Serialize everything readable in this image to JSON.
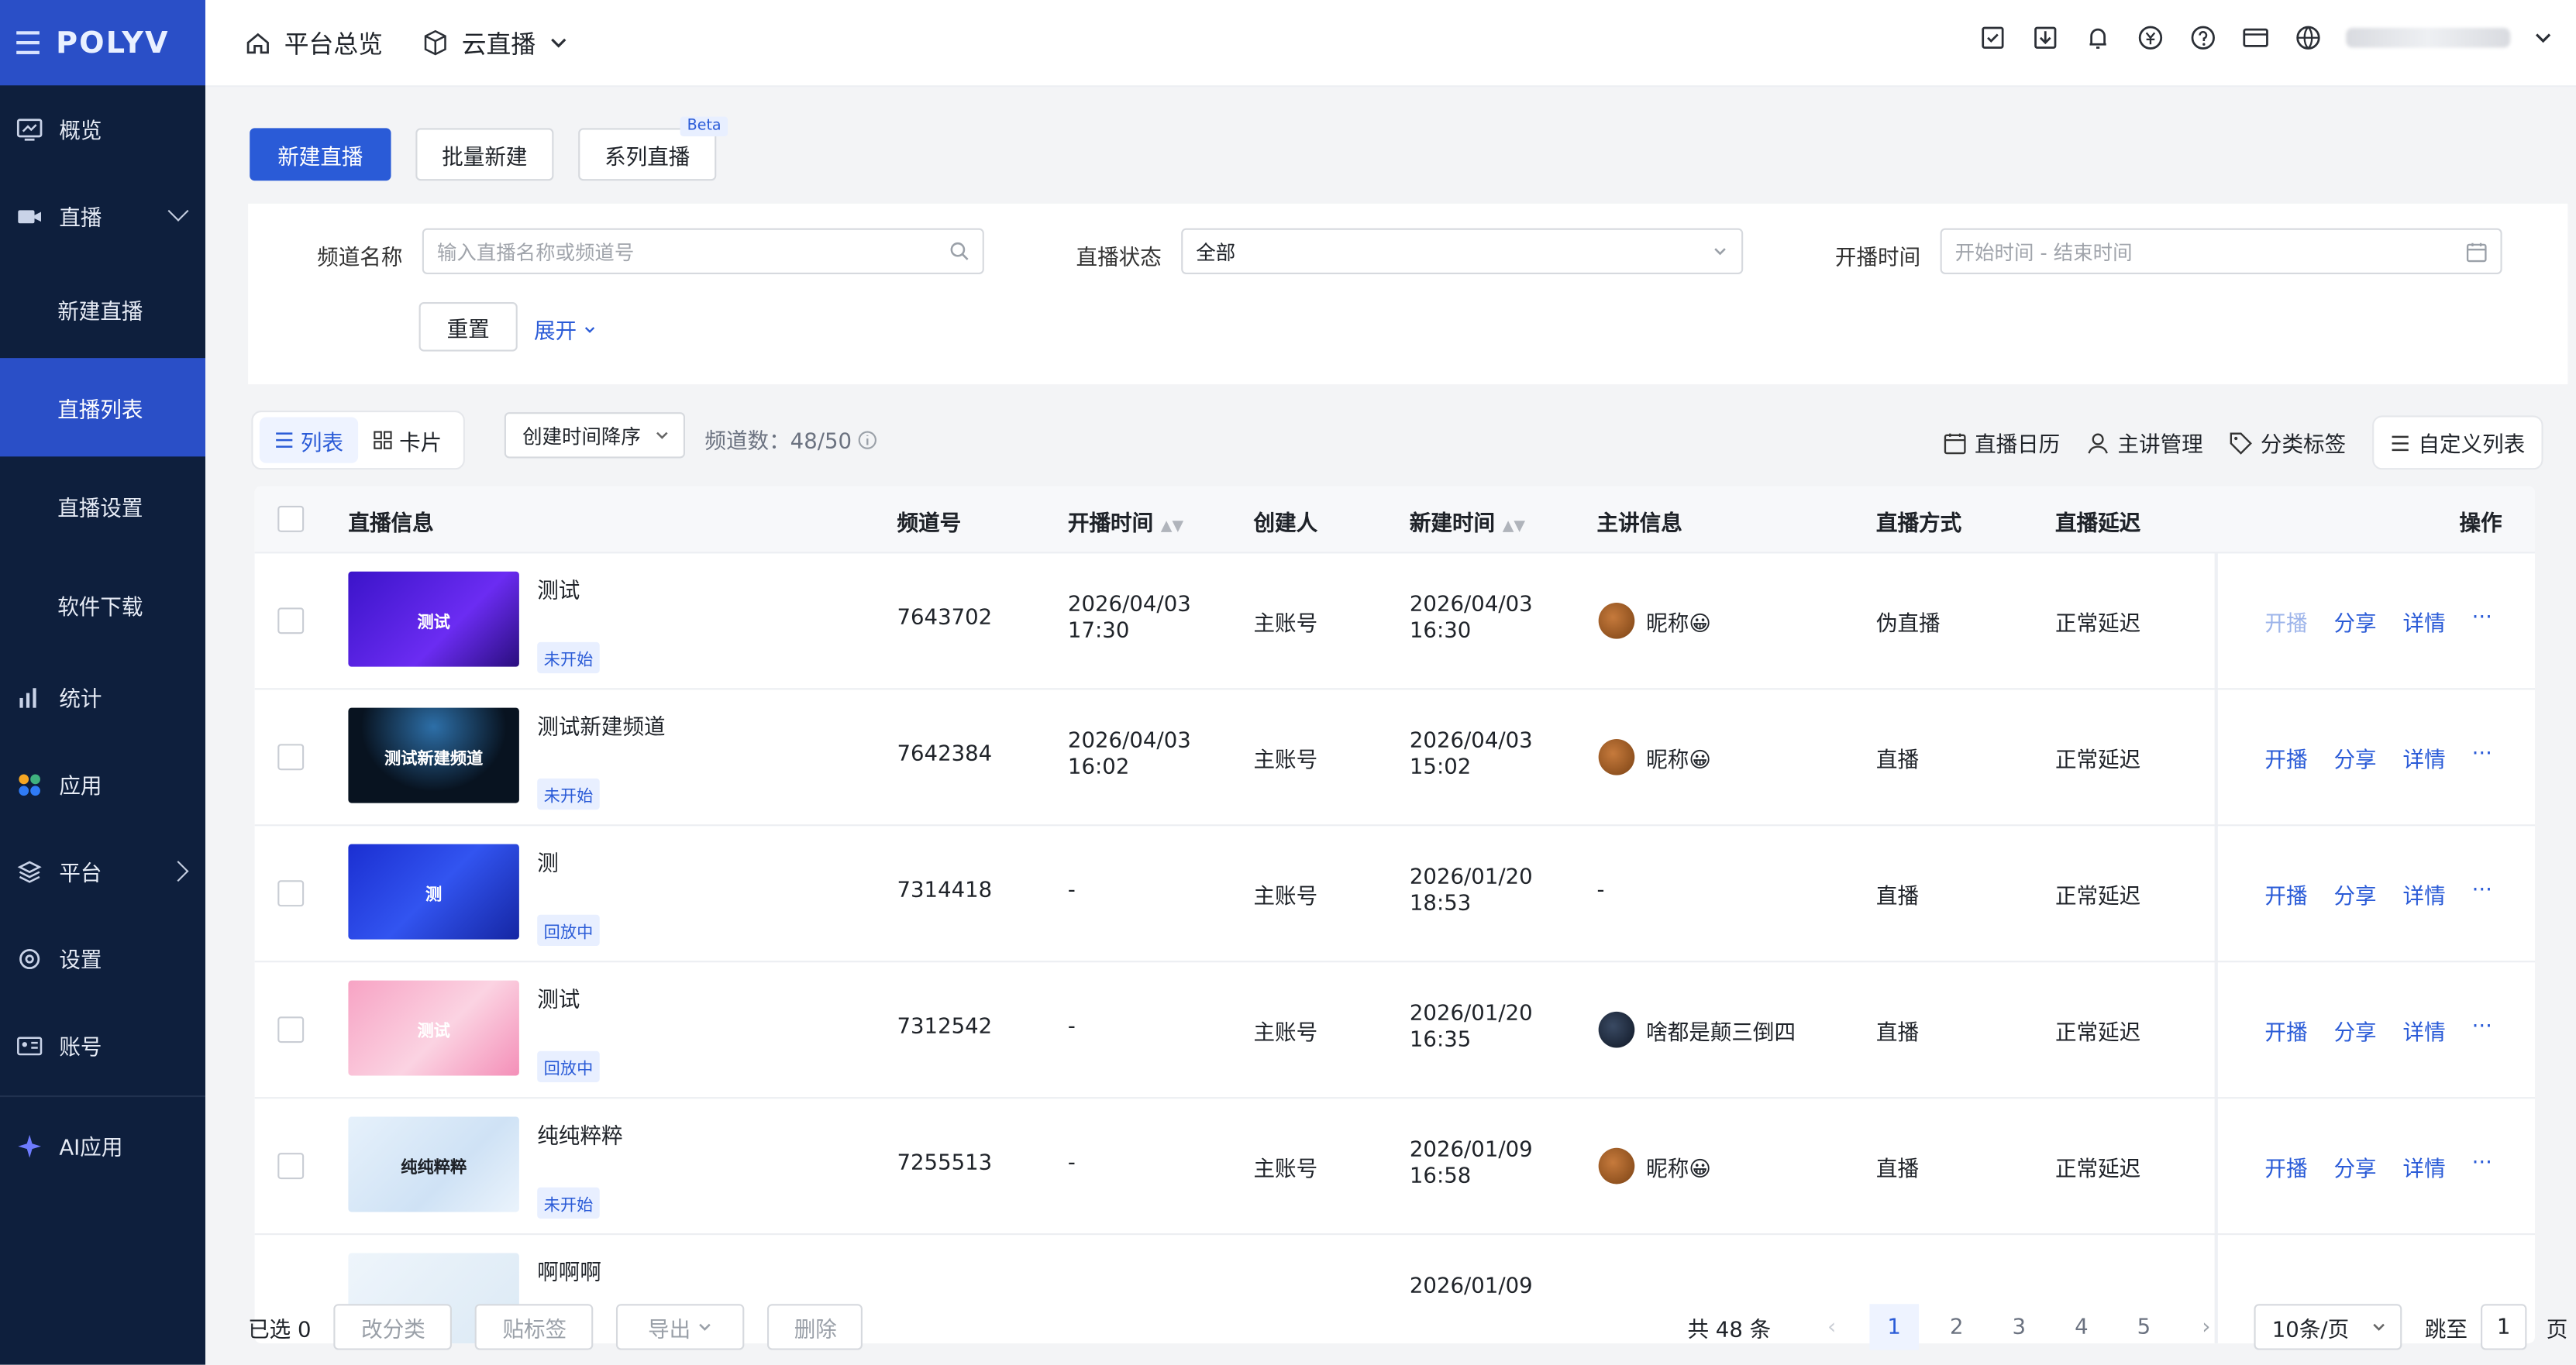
{
  "brand": {
    "logo": "POLYV",
    "accent": "#2a5bd7"
  },
  "sidebar": {
    "items": [
      {
        "label": "概览",
        "icon": "monitor-icon"
      },
      {
        "label": "直播",
        "icon": "video-icon"
      },
      {
        "label": "新建直播"
      },
      {
        "label": "直播列表",
        "active": true
      },
      {
        "label": "直播设置"
      },
      {
        "label": "软件下载"
      },
      {
        "label": "统计",
        "icon": "bar-chart-icon"
      },
      {
        "label": "应用",
        "icon": "apps-icon"
      },
      {
        "label": "平台",
        "icon": "layers-icon"
      },
      {
        "label": "设置",
        "icon": "gear-icon"
      },
      {
        "label": "账号",
        "icon": "id-card-icon"
      },
      {
        "label": "AI应用",
        "icon": "sparkle-icon"
      }
    ]
  },
  "header": {
    "overview": "平台总览",
    "product": "云直播"
  },
  "toolbar": {
    "new_live": "新建直播",
    "batch_new": "批量新建",
    "series_live": "系列直播",
    "beta": "Beta"
  },
  "filters": {
    "channel_label": "频道名称",
    "channel_placeholder": "输入直播名称或频道号",
    "status_label": "直播状态",
    "status_value": "全部",
    "time_label": "开播时间",
    "time_placeholder": "开始时间 - 结束时间",
    "reset": "重置",
    "expand": "展开"
  },
  "view": {
    "list": "列表",
    "card": "卡片",
    "sort": "创建时间降序",
    "count": "频道数：48/50"
  },
  "tools": {
    "calendar": "直播日历",
    "speaker": "主讲管理",
    "tags": "分类标签",
    "custom": "自定义列表"
  },
  "table": {
    "headers": [
      "直播信息",
      "频道号",
      "开播时间",
      "创建人",
      "新建时间",
      "主讲信息",
      "直播方式",
      "直播延迟",
      "操作"
    ],
    "rows": [
      {
        "title": "测试",
        "thumb": "测试",
        "badge": "未开始",
        "id": "7643702",
        "start1": "2026/04/03",
        "start2": "17:30",
        "creator": "主账号",
        "created1": "2026/04/03",
        "created2": "16:30",
        "speaker": "昵称😀",
        "mode": "伪直播",
        "delay": "正常延迟",
        "op1": "开播",
        "op2": "分享",
        "op3": "详情"
      },
      {
        "title": "测试新建频道",
        "thumb": "测试新建频道",
        "badge": "未开始",
        "id": "7642384",
        "start1": "2026/04/03",
        "start2": "16:02",
        "creator": "主账号",
        "created1": "2026/04/03",
        "created2": "15:02",
        "speaker": "昵称😀",
        "mode": "直播",
        "delay": "正常延迟",
        "op1": "开播",
        "op2": "分享",
        "op3": "详情"
      },
      {
        "title": "测",
        "thumb": "测",
        "badge": "回放中",
        "id": "7314418",
        "start1": "-",
        "start2": "",
        "creator": "主账号",
        "created1": "2026/01/20",
        "created2": "18:53",
        "speaker": "-",
        "mode": "直播",
        "delay": "正常延迟",
        "op1": "开播",
        "op2": "分享",
        "op3": "详情"
      },
      {
        "title": "测试",
        "thumb": "测试",
        "badge": "回放中",
        "id": "7312542",
        "start1": "-",
        "start2": "",
        "creator": "主账号",
        "created1": "2026/01/20",
        "created2": "16:35",
        "speaker": "啥都是颠三倒四",
        "mode": "直播",
        "delay": "正常延迟",
        "op1": "开播",
        "op2": "分享",
        "op3": "详情"
      },
      {
        "title": "纯纯粹粹",
        "thumb": "纯纯粹粹",
        "badge": "未开始",
        "id": "7255513",
        "start1": "-",
        "start2": "",
        "creator": "主账号",
        "created1": "2026/01/09",
        "created2": "16:58",
        "speaker": "昵称😀",
        "mode": "直播",
        "delay": "正常延迟",
        "op1": "开播",
        "op2": "分享",
        "op3": "详情"
      },
      {
        "title": "啊啊啊",
        "created1": "2026/01/09"
      }
    ],
    "more": "···"
  },
  "footer": {
    "selected": "已选 0",
    "reclassify": "改分类",
    "tag": "贴标签",
    "export": "导出",
    "delete": "删除",
    "total": "共 48 条",
    "pages": [
      "1",
      "2",
      "3",
      "4",
      "5"
    ],
    "page_size": "10条/页",
    "jump": "跳至",
    "jump_value": "1",
    "page_unit": "页"
  }
}
